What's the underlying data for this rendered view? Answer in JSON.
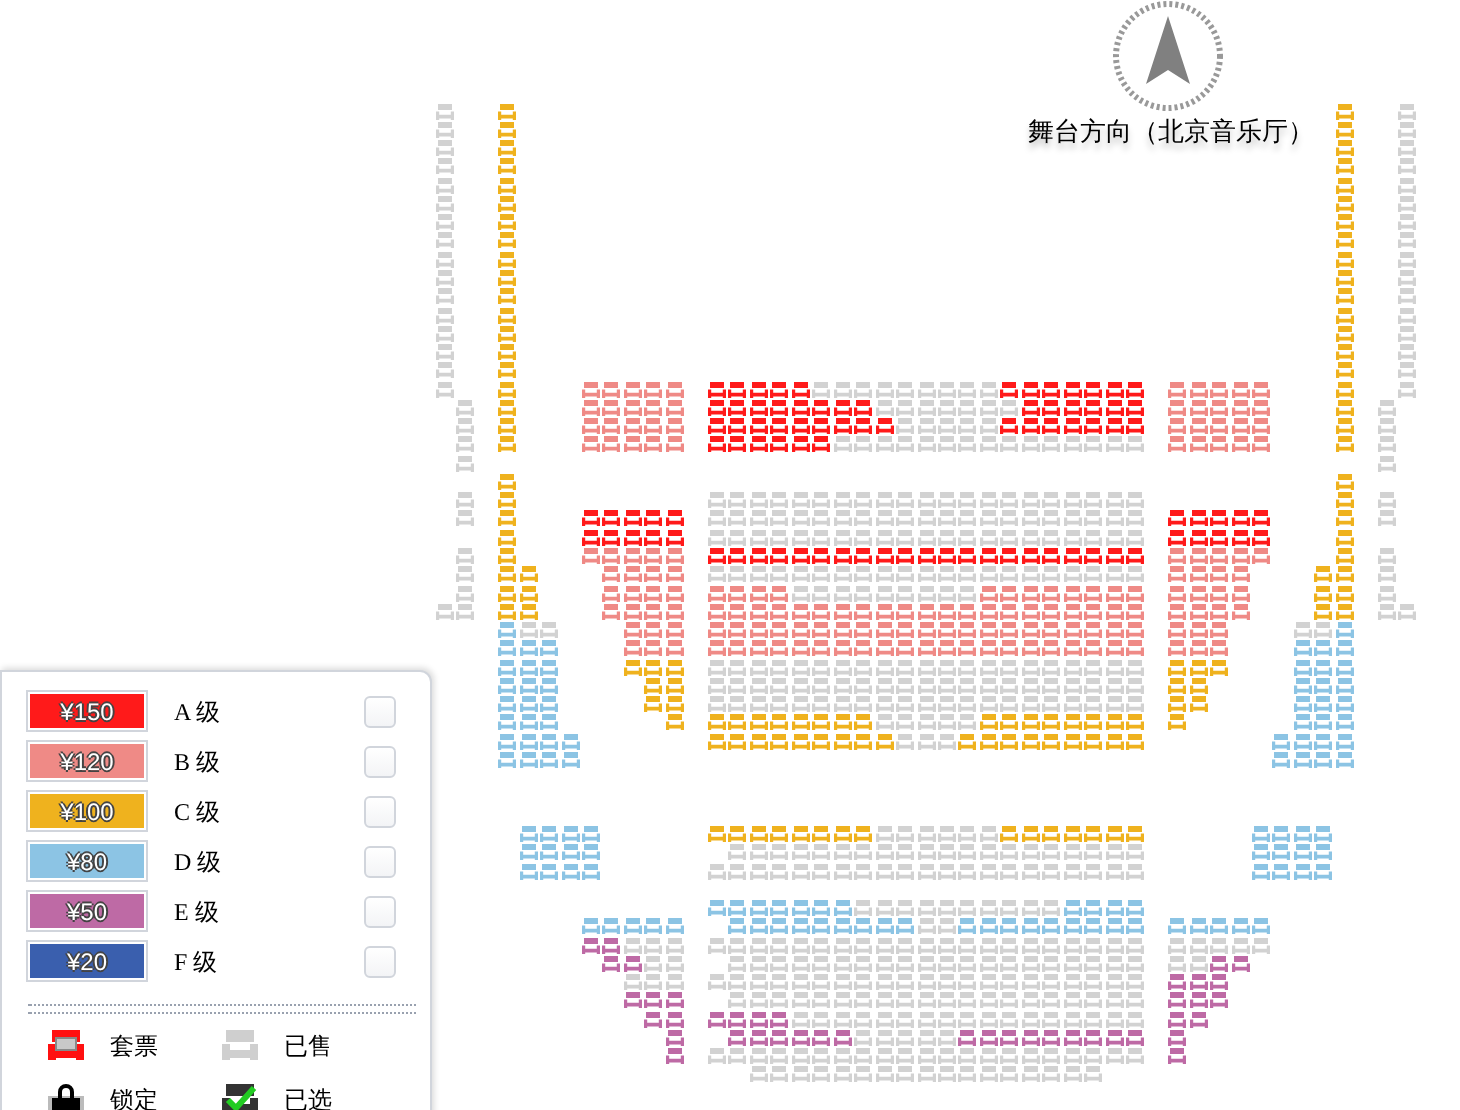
{
  "stage": {
    "label": "舞台方向（北京音乐厅）"
  },
  "legend": {
    "grades": [
      {
        "price": "¥150",
        "label": "A 级",
        "color": "#ff1a1a",
        "checked": false
      },
      {
        "price": "¥120",
        "label": "B 级",
        "color": "#ef8a86",
        "checked": false
      },
      {
        "price": "¥100",
        "label": "C 级",
        "color": "#efb21e",
        "checked": false
      },
      {
        "price": "¥80",
        "label": "D 级",
        "color": "#8cc4e4",
        "checked": false
      },
      {
        "price": "¥50",
        "label": "E 级",
        "color": "#be6aa5",
        "checked": false
      },
      {
        "price": "¥20",
        "label": "F 级",
        "color": "#3a5fae",
        "checked": false
      }
    ],
    "statuses": [
      {
        "kind": "package",
        "label": "套票"
      },
      {
        "kind": "sold",
        "label": "已售"
      },
      {
        "kind": "locked",
        "label": "锁定"
      },
      {
        "kind": "selected",
        "label": "已选"
      }
    ]
  }
}
